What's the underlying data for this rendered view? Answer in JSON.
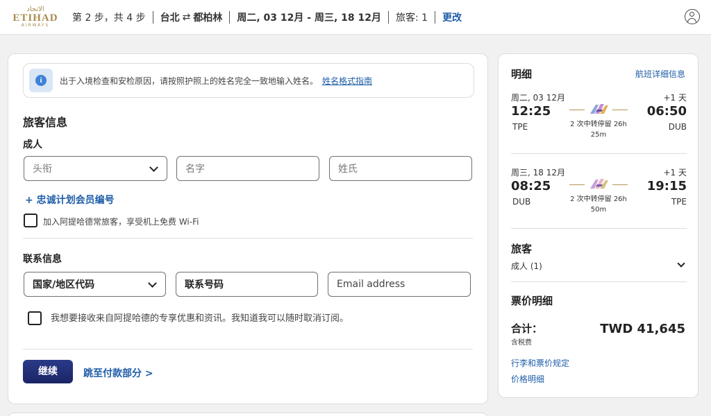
{
  "header": {
    "logo": {
      "arabic": "الاتحاد",
      "name": "ETIHAD",
      "tagline": "AIRWAYS"
    },
    "step": "第 2 步，共 4 步",
    "origin": "台北",
    "destination": "都柏林",
    "swap_icon": "⇄",
    "dates": "周二, 03 12月 - 周三, 18 12月",
    "passengers": "旅客: 1",
    "change_label": "更改"
  },
  "notice": {
    "icon": "i",
    "text": "出于入境检查和安检原因，请按照护照上的姓名完全一致地输入姓名。",
    "link": "姓名格式指南"
  },
  "traveler": {
    "title": "旅客信息",
    "subtitle": "成人",
    "fields": {
      "title_placeholder": "头衔",
      "first_name_placeholder": "名字",
      "last_name_placeholder": "姓氏"
    },
    "loyalty_link": "+ 忠诚计划会员编号",
    "join_checkbox_label": "加入阿提哈德常旅客，享受机上免费 Wi-Fi"
  },
  "contact": {
    "title": "联系信息",
    "country_code": "国家/地区代码",
    "phone": "联系号码",
    "email_placeholder": "Email address",
    "marketing_label": "我想要接收来自阿提哈德的专享优惠和资讯。我知道我可以随时取消订阅。"
  },
  "actions": {
    "continue": "继续",
    "skip": "跳至付款部分 >"
  },
  "summary": {
    "title": "明细",
    "details_link": "航班详细信息",
    "segments": [
      {
        "date": "周二, 03 12月",
        "plus_day": "+1 天",
        "dep_time": "12:25",
        "arr_time": "06:50",
        "dep_code": "TPE",
        "arr_code": "DUB",
        "stops_line1": "2 次中转停留 26h",
        "stops_line2": "25m"
      },
      {
        "date": "周三, 18 12月",
        "plus_day": "+1 天",
        "dep_time": "08:25",
        "arr_time": "19:15",
        "dep_code": "DUB",
        "arr_code": "TPE",
        "stops_line1": "2 次中转停留 26h",
        "stops_line2": "50m"
      }
    ],
    "travelers_title": "旅客",
    "travelers_sub": "成人 (1)",
    "fare_title": "票价明细",
    "total_label": "合计：",
    "total_sub": "含税费",
    "total_value": "TWD 41,645",
    "baggage_link": "行李和票价规定",
    "price_link": "价格明细"
  }
}
